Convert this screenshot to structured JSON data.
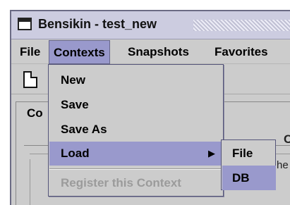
{
  "window": {
    "title": "Bensikin - test_new"
  },
  "menubar": {
    "items": [
      "File",
      "Contexts",
      "Snapshots",
      "Favorites"
    ]
  },
  "background": {
    "panel_legend": "Co",
    "partial_text_right": "C",
    "partial_text_row": "he"
  },
  "contexts_menu": {
    "items": [
      {
        "label": "New",
        "state": "normal"
      },
      {
        "label": "Save",
        "state": "normal"
      },
      {
        "label": "Save As",
        "state": "normal"
      },
      {
        "label": "Load",
        "state": "highlighted",
        "has_submenu": true
      },
      {
        "label": "Register this Context",
        "state": "disabled"
      }
    ],
    "submenu_arrow": "▶"
  },
  "load_submenu": {
    "items": [
      {
        "label": "File",
        "state": "normal"
      },
      {
        "label": "DB",
        "state": "highlighted"
      }
    ]
  },
  "colors": {
    "highlight": "#9999cc",
    "menu_bg": "#cccccc",
    "disabled_text": "#9b9b9b",
    "title_bg": "#cccce0"
  },
  "icons": {
    "window_icon": "window-icon",
    "new_document": "new-document-icon"
  }
}
